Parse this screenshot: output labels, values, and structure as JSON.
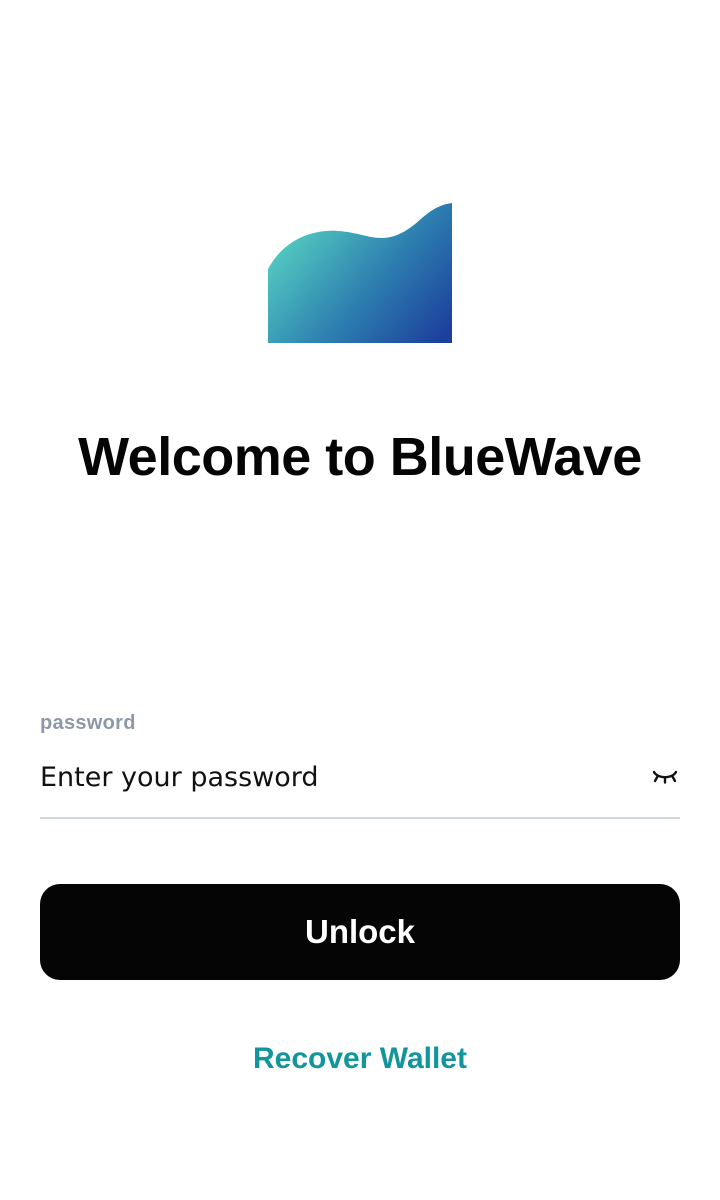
{
  "app": {
    "logo_icon": "bluewave-wave-logo",
    "logo_gradient": [
      "#57d3c2",
      "#2d7fb0",
      "#1c3f9c"
    ],
    "title": "Welcome to BlueWave"
  },
  "password_field": {
    "label": "password",
    "value": "",
    "placeholder": "Enter your password",
    "toggle_icon": "eye-closed-icon"
  },
  "actions": {
    "unlock_label": "Unlock",
    "recover_label": "Recover Wallet"
  },
  "colors": {
    "primary_button": "#050505",
    "link": "#12969b",
    "label": "#8d99ab",
    "divider": "#cfd6df"
  }
}
